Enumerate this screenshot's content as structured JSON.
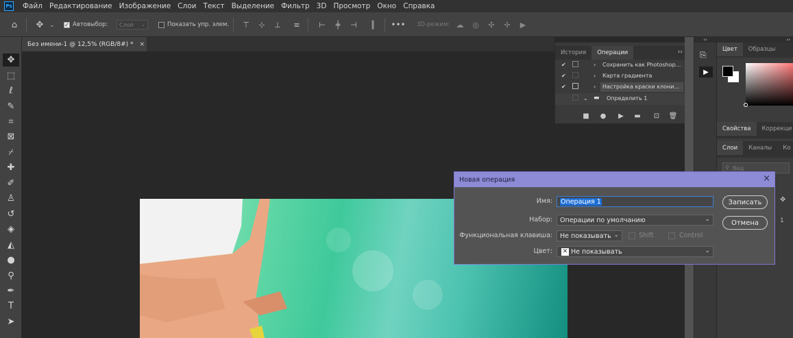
{
  "menubar": {
    "logo": "Ps",
    "items": [
      "Файл",
      "Редактирование",
      "Изображение",
      "Слои",
      "Текст",
      "Выделение",
      "Фильтр",
      "3D",
      "Просмотр",
      "Окно",
      "Справка"
    ]
  },
  "options": {
    "autoselect_label": "Автовыбор:",
    "autoselect_value": "Слой",
    "show_controls_label": "Показать упр. элем.",
    "mode_3d_label": "3D-режим:"
  },
  "document": {
    "tab_title": "Без имени-1 @ 12,5% (RGB/8#) *",
    "close_glyph": "×"
  },
  "actions_panel": {
    "tabs": [
      "История",
      "Операции"
    ],
    "rows": [
      {
        "label": "Сохранить как Photoshop..."
      },
      {
        "label": "Карта градиента"
      },
      {
        "label": "Настройка краски клони..."
      },
      {
        "label": "Определить 1"
      }
    ]
  },
  "right_panels": {
    "top_tabs": [
      "Цвет",
      "Образцы"
    ],
    "mid_tabs": [
      "Свойства",
      "Коррекци"
    ],
    "layer_tabs": [
      "Слои",
      "Каналы",
      "Ко"
    ],
    "search_placeholder": "Вид"
  },
  "dialog": {
    "title": "Новая операция",
    "close_glyph": "×",
    "name_label": "Имя:",
    "name_value": "Операция 1",
    "set_label": "Набор:",
    "set_value": "Операции по умолчанию",
    "fkey_label": "Функциональная клавиша:",
    "fkey_value": "Не показывать",
    "shift_label": "Shift",
    "control_label": "Control",
    "color_label": "Цвет:",
    "color_value": "Не показывать",
    "record_button": "Записать",
    "cancel_button": "Отмена"
  },
  "colors": {
    "dialog_title_bar": "#8d8ad6",
    "selection": "#1d6fd8",
    "ps_blue": "#31a8ff"
  }
}
